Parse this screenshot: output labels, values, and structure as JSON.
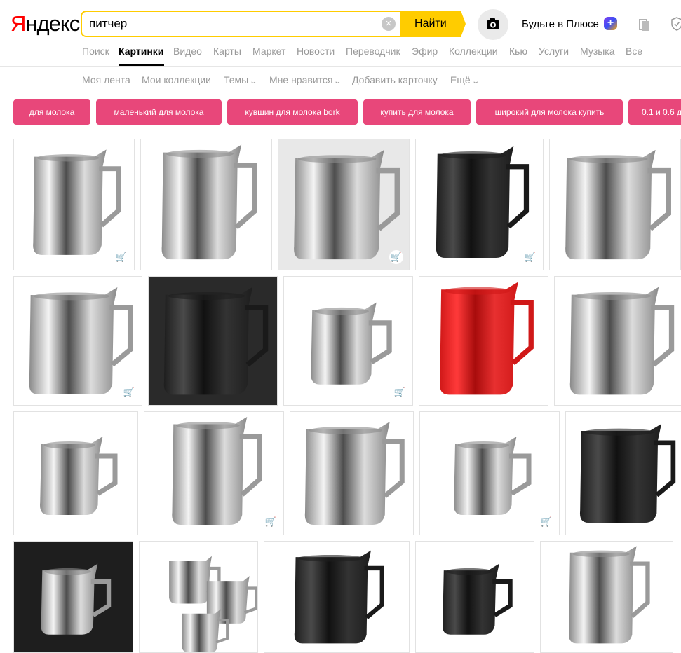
{
  "logo": {
    "first_letter": "Я",
    "rest": "ндекс"
  },
  "search": {
    "query": "питчер",
    "clear_label": "×",
    "button_label": "Найти"
  },
  "header": {
    "plus_link": "Будьте в Плюсе",
    "plus_badge": "+"
  },
  "nav": [
    {
      "label": "Поиск",
      "active": false
    },
    {
      "label": "Картинки",
      "active": true
    },
    {
      "label": "Видео",
      "active": false
    },
    {
      "label": "Карты",
      "active": false
    },
    {
      "label": "Маркет",
      "active": false
    },
    {
      "label": "Новости",
      "active": false
    },
    {
      "label": "Переводчик",
      "active": false
    },
    {
      "label": "Эфир",
      "active": false
    },
    {
      "label": "Коллекции",
      "active": false
    },
    {
      "label": "Кью",
      "active": false
    },
    {
      "label": "Услуги",
      "active": false
    },
    {
      "label": "Музыка",
      "active": false
    },
    {
      "label": "Все",
      "active": false
    }
  ],
  "subnav": [
    {
      "label": "Моя лента",
      "dropdown": false
    },
    {
      "label": "Мои коллекции",
      "dropdown": false
    },
    {
      "label": "Темы",
      "dropdown": true
    },
    {
      "label": "Мне нравится",
      "dropdown": true
    },
    {
      "label": "Добавить карточку",
      "dropdown": false
    },
    {
      "label": "Ещё",
      "dropdown": true
    }
  ],
  "tags": [
    "для молока",
    "маленький для молока",
    "кувшин для молока bork",
    "купить для молока",
    "широкий для молока купить",
    "0.1 и 0.6 д"
  ],
  "colors": {
    "accent": "#ffcc00",
    "tag": "#e8477a",
    "cart": "#0a60ff",
    "logo_red": "#ff0000"
  },
  "images": [
    {
      "row": 0,
      "finish": "steel",
      "shape": "tall",
      "bg": "#ffffff",
      "cart": true
    },
    {
      "row": 0,
      "finish": "steel",
      "shape": "tall",
      "bg": "#ffffff",
      "cart": false
    },
    {
      "row": 0,
      "finish": "steel",
      "shape": "wide",
      "bg": "#e8e8e8",
      "cart": true
    },
    {
      "row": 0,
      "finish": "black",
      "shape": "tall",
      "bg": "#ffffff",
      "cart": true
    },
    {
      "row": 0,
      "finish": "steel",
      "shape": "wide",
      "bg": "#ffffff",
      "cart": false
    },
    {
      "row": 1,
      "finish": "steel",
      "shape": "wide",
      "bg": "#ffffff",
      "cart": true
    },
    {
      "row": 1,
      "finish": "black",
      "shape": "wide",
      "bg": "#2a2a2a",
      "cart": false
    },
    {
      "row": 1,
      "finish": "steel",
      "shape": "small",
      "bg": "#ffffff",
      "cart": true
    },
    {
      "row": 1,
      "finish": "red",
      "shape": "tall",
      "bg": "#ffffff",
      "cart": false
    },
    {
      "row": 1,
      "finish": "steel",
      "shape": "wide",
      "bg": "#ffffff",
      "cart": false
    },
    {
      "row": 2,
      "finish": "steel",
      "shape": "small",
      "bg": "#ffffff",
      "cart": false
    },
    {
      "row": 2,
      "finish": "steel",
      "shape": "tall",
      "bg": "#ffffff",
      "cart": true
    },
    {
      "row": 2,
      "finish": "steel",
      "shape": "wide",
      "bg": "#ffffff",
      "cart": false
    },
    {
      "row": 2,
      "finish": "steel",
      "shape": "small",
      "bg": "#ffffff",
      "cart": true
    },
    {
      "row": 2,
      "finish": "black",
      "shape": "wide",
      "bg": "#ffffff",
      "cart": false
    },
    {
      "row": 3,
      "finish": "steel",
      "shape": "small",
      "bg": "#1e1e1e",
      "cart": false
    },
    {
      "row": 3,
      "finish": "steel",
      "shape": "group",
      "bg": "#ffffff",
      "cart": false
    },
    {
      "row": 3,
      "finish": "black",
      "shape": "wide",
      "bg": "#ffffff",
      "cart": false
    },
    {
      "row": 3,
      "finish": "black",
      "shape": "small",
      "bg": "#ffffff",
      "cart": false
    },
    {
      "row": 3,
      "finish": "steel",
      "shape": "tall",
      "bg": "#ffffff",
      "cart": false
    }
  ]
}
